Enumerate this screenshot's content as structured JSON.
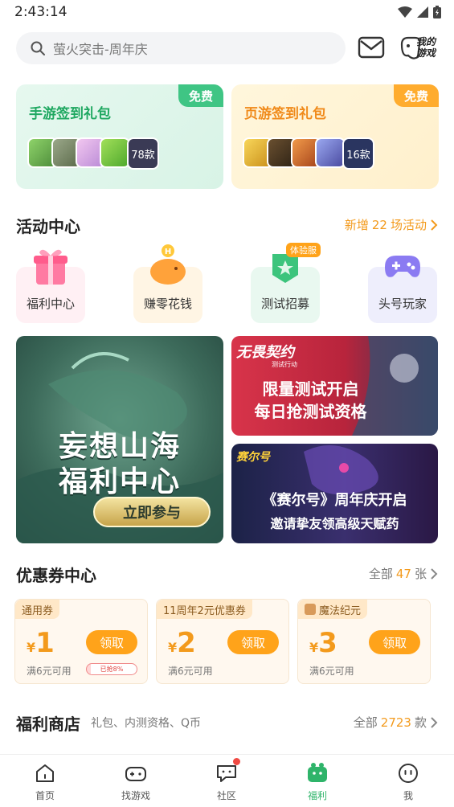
{
  "status_bar": {
    "time": "2:43:14"
  },
  "search": {
    "placeholder": "萤火突击-周年庆"
  },
  "mygame_label_line1": "我的",
  "mygame_label_line2": "游戏",
  "gift_cards": [
    {
      "title": "手游签到礼包",
      "badge": "免费",
      "count": "78款"
    },
    {
      "title": "页游签到礼包",
      "badge": "免费",
      "count": "16款"
    }
  ],
  "activity_center": {
    "title": "活动中心",
    "subtitle_prefix": "新增",
    "subtitle_count": "22",
    "subtitle_suffix": "场活动",
    "items": [
      {
        "label": "福利中心",
        "icon": "gift-box-icon"
      },
      {
        "label": "赚零花钱",
        "icon": "piggy-bank-icon"
      },
      {
        "label": "测试招募",
        "icon": "trial-badge-icon",
        "tag": "体验服"
      },
      {
        "label": "头号玩家",
        "icon": "gamepad-icon"
      }
    ]
  },
  "banners": {
    "big": {
      "line1": "妄想山海",
      "line2": "福利中心",
      "button": "立即参与"
    },
    "small1": {
      "logo": "无畏契约",
      "logo_sub": "测试行动",
      "line1": "限量测试开启",
      "line2": "每日抢测试资格"
    },
    "small2": {
      "logo": "赛尔号",
      "line1": "《赛尔号》周年庆开启",
      "line2": "邀请挚友领高级天赋药"
    }
  },
  "coupon_center": {
    "title": "优惠券中心",
    "all_label": "全部",
    "all_count": "47",
    "all_unit": "张",
    "coupons": [
      {
        "tag": "通用券",
        "yen": "¥",
        "amount": "1",
        "button": "领取",
        "condition": "满6元可用",
        "claimed": "已抢8%"
      },
      {
        "tag": "11周年2元优惠券",
        "yen": "¥",
        "amount": "2",
        "button": "领取",
        "condition": "满6元可用"
      },
      {
        "tag": "魔法纪元",
        "yen": "¥",
        "amount": "3",
        "button": "领取",
        "condition": "满6元可用"
      }
    ]
  },
  "welfare_store": {
    "title": "福利商店",
    "subtitle": "礼包、内测资格、Q币",
    "all_label": "全部",
    "all_count": "2723",
    "all_unit": "款"
  },
  "tabbar": {
    "items": [
      {
        "label": "首页",
        "icon": "home-icon"
      },
      {
        "label": "找游戏",
        "icon": "gamepad-icon"
      },
      {
        "label": "社区",
        "icon": "chat-bubble-icon"
      },
      {
        "label": "福利",
        "icon": "welfare-icon",
        "active": true
      },
      {
        "label": "我",
        "icon": "profile-icon"
      }
    ]
  },
  "colors": {
    "brand_green": "#2fb46a",
    "accent_orange": "#ffa31a",
    "notification_red": "#f04a43"
  }
}
